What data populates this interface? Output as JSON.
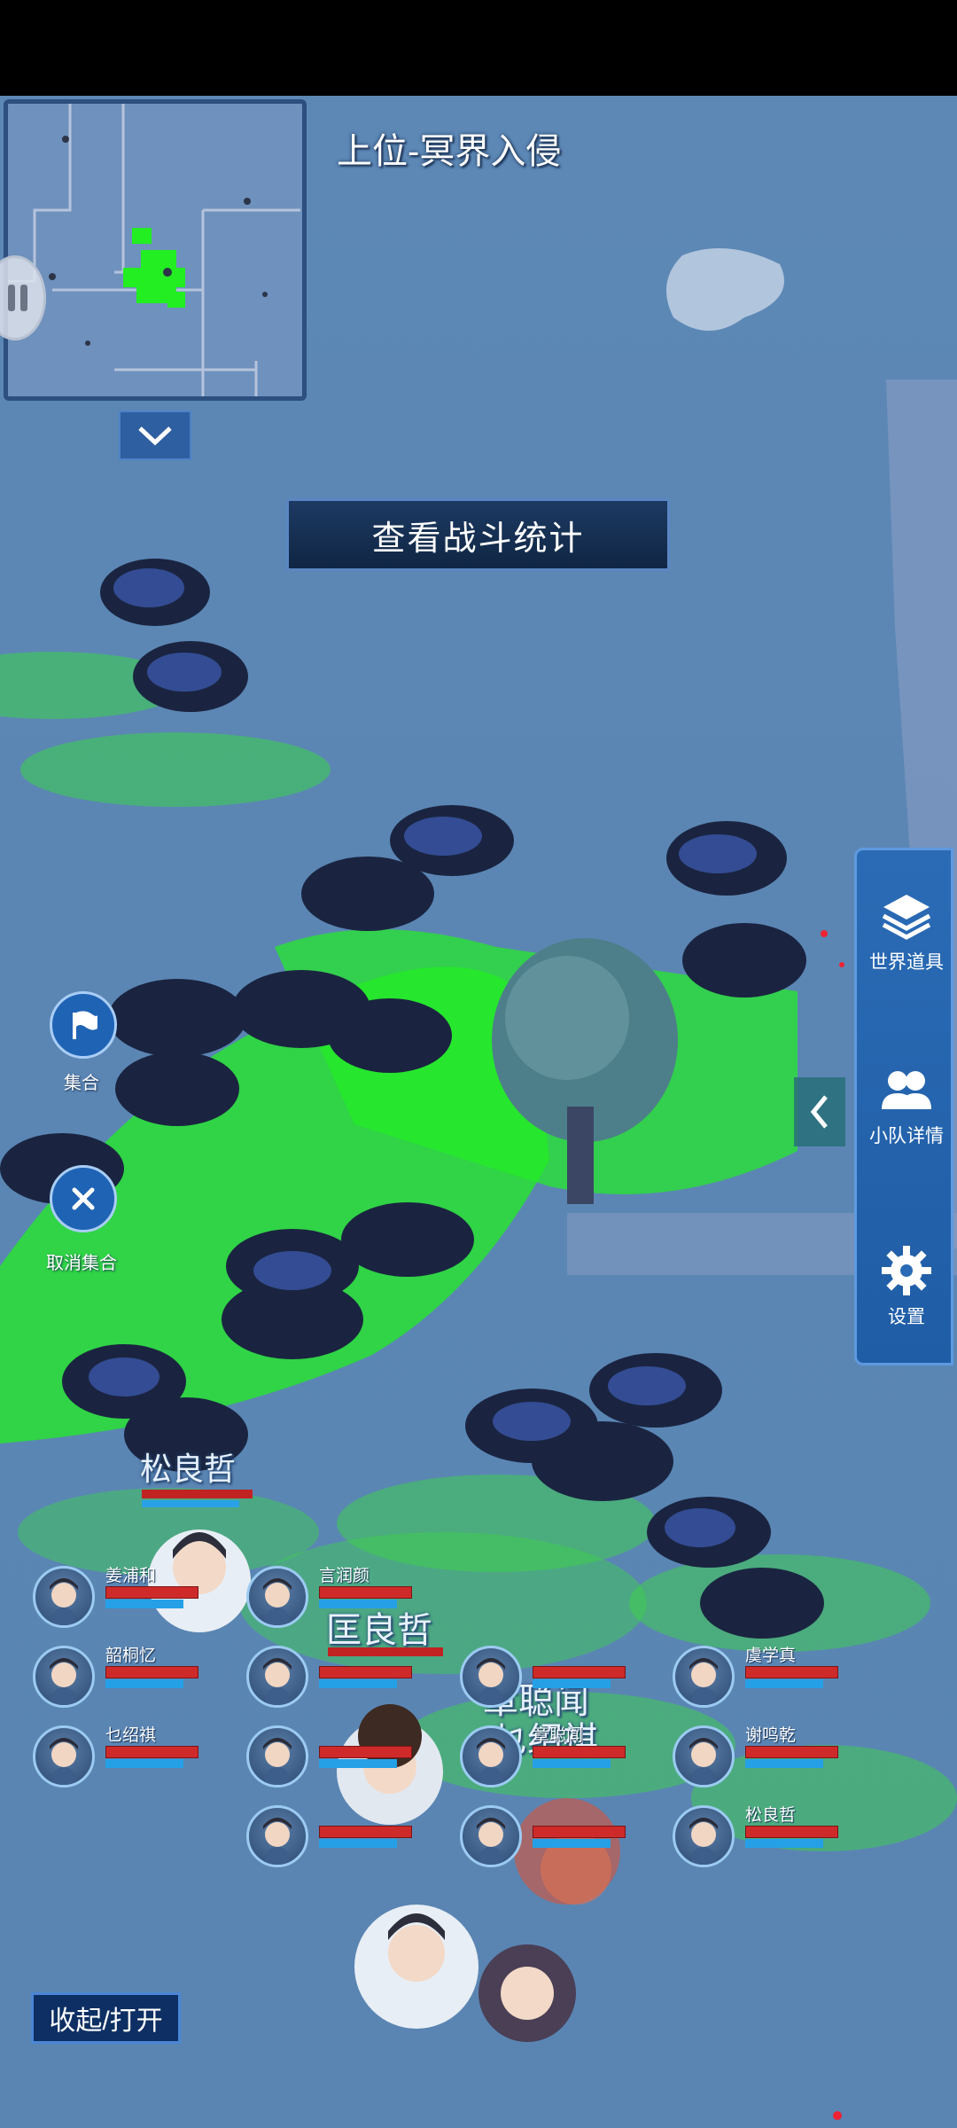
{
  "hud": {
    "stage_title": "上位-冥界入侵",
    "battle_stats_button": "查看战斗统计",
    "collapse_toggle": "收起/打开"
  },
  "left_actions": {
    "rally_label": "集合",
    "cancel_rally_label": "取消集合"
  },
  "side_panel": {
    "items": [
      {
        "label": "世界道具",
        "icon": "layers-icon"
      },
      {
        "label": "小队详情",
        "icon": "team-icon"
      },
      {
        "label": "设置",
        "icon": "gear-icon"
      }
    ]
  },
  "world_labels": {
    "char1": "松良哲",
    "char2": "匡良哲",
    "char3": "章聪闻",
    "char4": "乜绍祺"
  },
  "team": {
    "slots": [
      {
        "name": "姜浦和",
        "hp": 1.0,
        "mp": 0.85
      },
      {
        "name": "言润颜",
        "hp": 1.0,
        "mp": 0.85
      },
      {
        "name": "",
        "hp": 0.0,
        "mp": 0.0
      },
      {
        "name": "",
        "hp": 0.0,
        "mp": 0.0
      },
      {
        "name": "韶桐忆",
        "hp": 1.0,
        "mp": 0.85
      },
      {
        "name": "",
        "hp": 1.0,
        "mp": 0.85
      },
      {
        "name": "",
        "hp": 1.0,
        "mp": 0.85
      },
      {
        "name": "虞学真",
        "hp": 1.0,
        "mp": 0.85
      },
      {
        "name": "乜绍祺",
        "hp": 1.0,
        "mp": 0.85
      },
      {
        "name": "",
        "hp": 1.0,
        "mp": 0.85
      },
      {
        "name": "章聪闻",
        "hp": 1.0,
        "mp": 0.85
      },
      {
        "name": "谢鸣乾",
        "hp": 1.0,
        "mp": 0.85
      },
      {
        "name": "",
        "hp": 1.0,
        "mp": 0.85
      },
      {
        "name": "",
        "hp": 1.0,
        "mp": 0.85
      },
      {
        "name": "松良哲",
        "hp": 1.0,
        "mp": 0.85
      }
    ]
  },
  "colors": {
    "hp": "#cf2a2a",
    "mp": "#25a0e6",
    "highlight": "#22ee22",
    "panel": "#1f5da6"
  }
}
